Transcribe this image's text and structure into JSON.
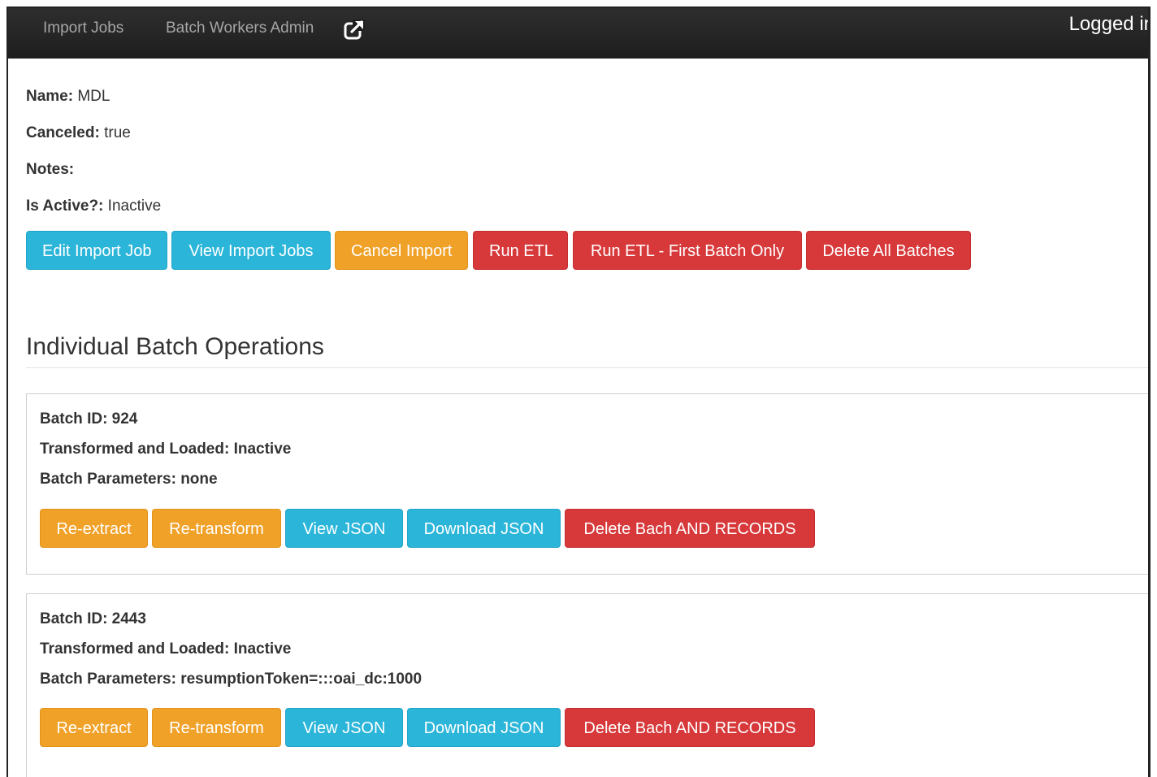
{
  "navbar": {
    "import_jobs": "Import Jobs",
    "batch_workers_admin": "Batch Workers Admin",
    "external_icon": "external-link-icon",
    "logged_in": "Logged in"
  },
  "job": {
    "name_label": "Name:",
    "name_value": "MDL",
    "canceled_label": "Canceled:",
    "canceled_value": "true",
    "notes_label": "Notes:",
    "notes_value": "",
    "active_label": "Is Active?:",
    "active_value": "Inactive"
  },
  "actions": {
    "edit": "Edit Import Job",
    "view": "View Import Jobs",
    "cancel": "Cancel Import",
    "run_etl": "Run ETL",
    "run_etl_first": "Run ETL - First Batch Only",
    "delete_all": "Delete All Batches"
  },
  "section": {
    "title": "Individual Batch Operations"
  },
  "batches": [
    {
      "id_text": "Batch ID: 924",
      "loaded_text": "Transformed and Loaded: Inactive",
      "params_text": "Batch Parameters: none",
      "buttons": {
        "re_extract": "Re-extract",
        "re_transform": "Re-transform",
        "view_json": "View JSON",
        "download_json": "Download JSON",
        "delete": "Delete Bach AND RECORDS"
      }
    },
    {
      "id_text": "Batch ID: 2443",
      "loaded_text": "Transformed and Loaded: Inactive",
      "params_text": "Batch Parameters: resumptionToken=:::oai_dc:1000",
      "buttons": {
        "re_extract": "Re-extract",
        "re_transform": "Re-transform",
        "view_json": "View JSON",
        "download_json": "Download JSON",
        "delete": "Delete Bach AND RECORDS"
      }
    }
  ],
  "colors": {
    "info": "#2bb5d9",
    "warning": "#f0a128",
    "danger": "#d7383a",
    "navbar": "#222222"
  }
}
